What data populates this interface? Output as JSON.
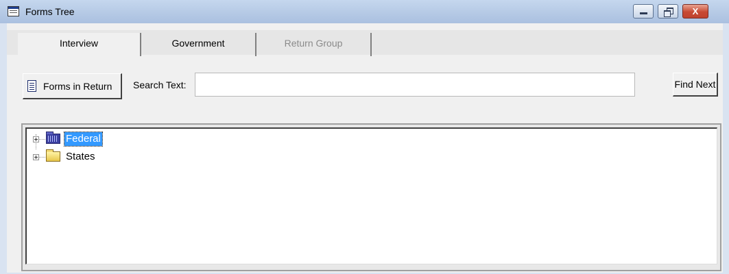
{
  "window": {
    "title": "Forms Tree",
    "close_glyph": "X"
  },
  "tabs": [
    {
      "label": "Interview",
      "accel": "I",
      "state": "active"
    },
    {
      "label": "Government",
      "accel": "G",
      "state": "normal"
    },
    {
      "label": "Return Group",
      "accel": "p",
      "state": "disabled"
    }
  ],
  "toolbar": {
    "forms_button": "Forms in Return",
    "forms_button_icon": "document-icon",
    "search_label": "Search Text:",
    "search_value": "",
    "find_button": "Find Next"
  },
  "tree": {
    "nodes": [
      {
        "label": "Federal",
        "icon": "federal-folder-icon",
        "selected": true,
        "expander": "+"
      },
      {
        "label": "States",
        "icon": "folder-icon",
        "selected": false,
        "expander": "+"
      }
    ]
  },
  "colors": {
    "selection": "#3399ff",
    "titlebar": "#b7cbe6",
    "close": "#c74a34"
  }
}
